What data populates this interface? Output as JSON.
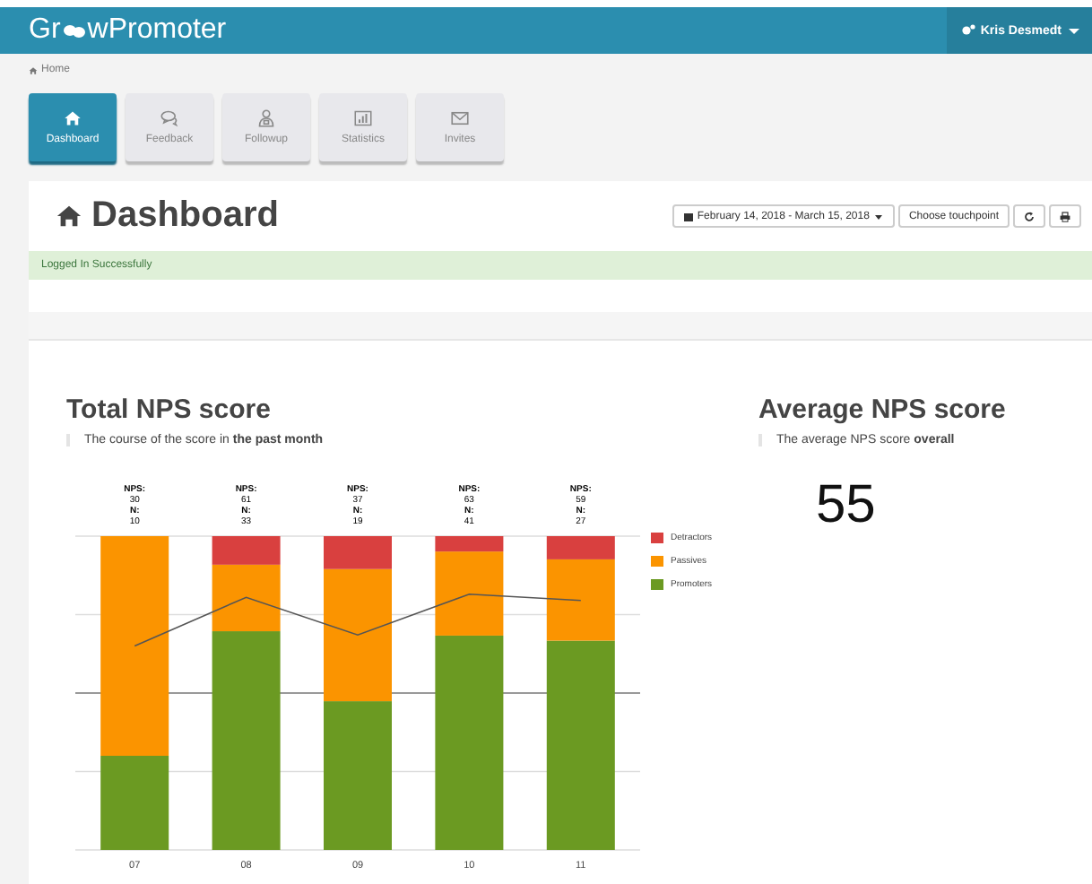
{
  "navbar": {
    "logo_start": "Gr",
    "logo_end": "wPromoter",
    "user": "Kris Desmedt"
  },
  "breadcrumb": "Home",
  "tiles": [
    {
      "label": "Dashboard",
      "selected": true
    },
    {
      "label": "Feedback",
      "selected": false
    },
    {
      "label": "Followup",
      "selected": false
    },
    {
      "label": "Statistics",
      "selected": false
    },
    {
      "label": "Invites",
      "selected": false
    }
  ],
  "page_title": "Dashboard",
  "toolbar": {
    "date_range": "February 14, 2018 - March 15, 2018",
    "touchpoint_button": "Choose touchpoint"
  },
  "alert": "Logged In Successfully",
  "total_nps": {
    "title": "Total NPS score",
    "subtitle": "The course of the score in **the past month**",
    "bar_labels": [
      {
        "nps_caption": "NPS:",
        "nps": "30",
        "n_caption": "N:",
        "n": "10"
      },
      {
        "nps_caption": "NPS:",
        "nps": "61",
        "n_caption": "N:",
        "n": "33"
      },
      {
        "nps_caption": "NPS:",
        "nps": "37",
        "n_caption": "N:",
        "n": "19"
      },
      {
        "nps_caption": "NPS:",
        "nps": "63",
        "n_caption": "N:",
        "n": "41"
      },
      {
        "nps_caption": "NPS:",
        "nps": "59",
        "n_caption": "N:",
        "n": "27"
      }
    ],
    "categories": [
      "07",
      "08",
      "09",
      "10",
      "11"
    ],
    "legend": [
      {
        "name": "Detractors",
        "color": "#d9403f"
      },
      {
        "name": "Passives",
        "color": "#fb9400"
      },
      {
        "name": "Promoters",
        "color": "#6b9a22"
      }
    ]
  },
  "average_nps": {
    "title": "Average NPS score",
    "subtitle": "The average NPS score **overall**",
    "value": "55"
  }
}
